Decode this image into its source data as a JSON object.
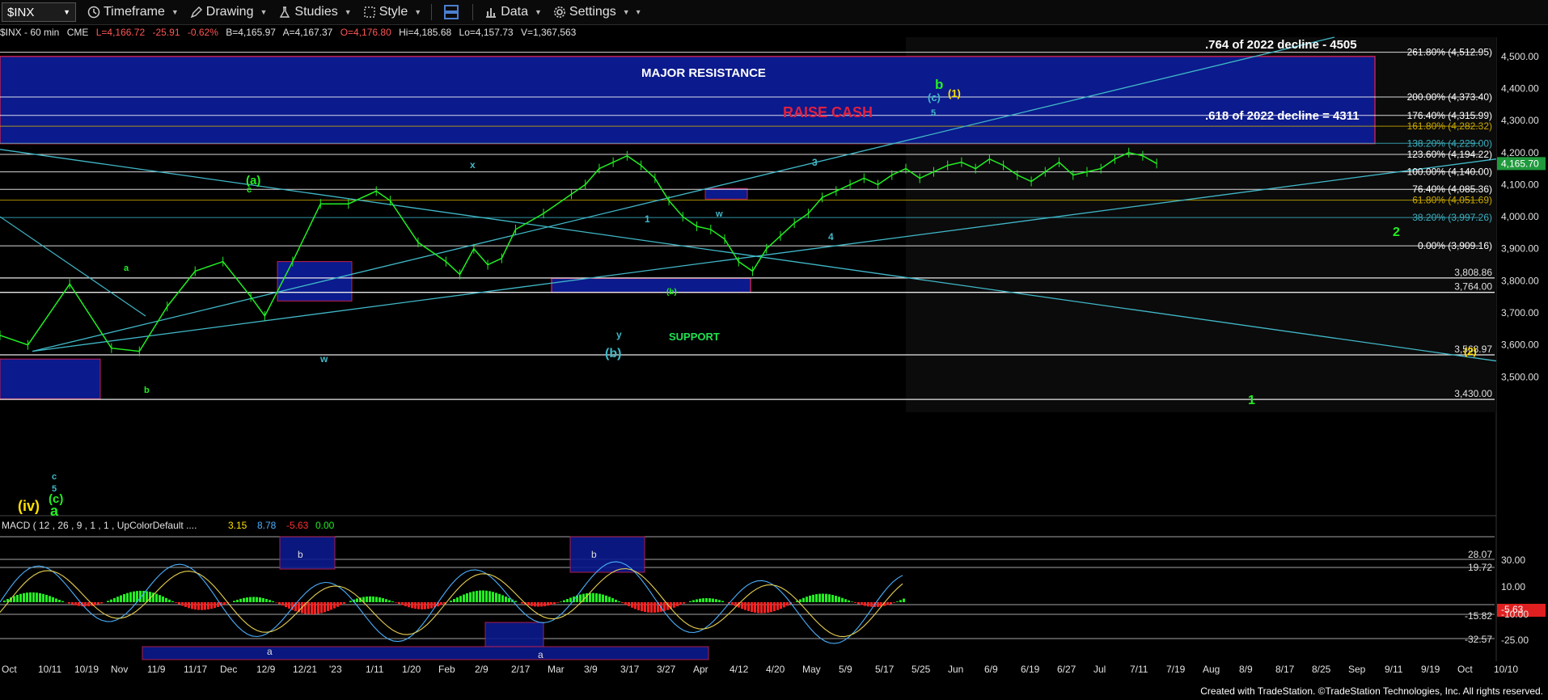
{
  "toolbar": {
    "symbol": "$INX",
    "timeframe": "Timeframe",
    "drawing": "Drawing",
    "studies": "Studies",
    "style": "Style",
    "data": "Data",
    "settings": "Settings"
  },
  "infobar": {
    "symbol": "$INX - 60 min",
    "exchange": "CME",
    "last": "L=4,166.72",
    "change": "-25.91",
    "change_pct": "-0.62%",
    "bid": "B=4,165.97",
    "ask": "A=4,167.37",
    "open": "O=4,176.80",
    "high": "Hi=4,185.68",
    "low": "Lo=4,157.73",
    "volume": "V=1,367,563"
  },
  "footer": "Created with TradeStation. ©TradeStation Technologies, Inc. All rights reserved.",
  "chart_data": {
    "type": "line",
    "title": "$INX - 60 min",
    "ylim": [
      3390,
      4560
    ],
    "y_ticks": [
      "4,500.00",
      "4,400.00",
      "4,300.00",
      "4,200.00",
      "4,100.00",
      "4,000.00",
      "3,900.00",
      "3,800.00",
      "3,700.00",
      "3,600.00",
      "3,500.00"
    ],
    "x_tick_labels": [
      "Oct",
      "10/11",
      "10/19",
      "Nov",
      "11/9",
      "11/17",
      "Dec",
      "12/9",
      "12/21",
      "'23",
      "1/11",
      "1/20",
      "Feb",
      "2/9",
      "2/17",
      "Mar",
      "3/9",
      "3/17",
      "3/27",
      "Apr",
      "4/12",
      "4/20",
      "May",
      "5/9",
      "5/17",
      "5/25",
      "Jun",
      "6/9",
      "6/19",
      "6/27",
      "Jul",
      "7/11",
      "7/19",
      "Aug",
      "8/9",
      "8/17",
      "8/25",
      "Sep",
      "9/11",
      "9/19",
      "Oct",
      "10/10"
    ],
    "last_price": "4,165.70",
    "price_series": [
      [
        0,
        3630
      ],
      [
        2,
        3600
      ],
      [
        5,
        3790
      ],
      [
        8,
        3590
      ],
      [
        10,
        3580
      ],
      [
        12,
        3720
      ],
      [
        14,
        3830
      ],
      [
        16,
        3860
      ],
      [
        18,
        3750
      ],
      [
        19,
        3690
      ],
      [
        21,
        3860
      ],
      [
        23,
        4040
      ],
      [
        25,
        4040
      ],
      [
        27,
        4080
      ],
      [
        28,
        4050
      ],
      [
        30,
        3920
      ],
      [
        32,
        3860
      ],
      [
        33,
        3820
      ],
      [
        34,
        3900
      ],
      [
        35,
        3850
      ],
      [
        36,
        3870
      ],
      [
        37,
        3960
      ],
      [
        39,
        4010
      ],
      [
        41,
        4070
      ],
      [
        42,
        4100
      ],
      [
        43,
        4150
      ],
      [
        44,
        4170
      ],
      [
        45,
        4190
      ],
      [
        46,
        4160
      ],
      [
        47,
        4120
      ],
      [
        48,
        4050
      ],
      [
        49,
        4000
      ],
      [
        50,
        3970
      ],
      [
        51,
        3960
      ],
      [
        52,
        3930
      ],
      [
        53,
        3860
      ],
      [
        54,
        3830
      ],
      [
        55,
        3900
      ],
      [
        56,
        3940
      ],
      [
        57,
        3980
      ],
      [
        58,
        4010
      ],
      [
        59,
        4060
      ],
      [
        60,
        4080
      ],
      [
        61,
        4100
      ],
      [
        62,
        4120
      ],
      [
        63,
        4100
      ],
      [
        64,
        4130
      ],
      [
        65,
        4150
      ],
      [
        66,
        4120
      ],
      [
        67,
        4140
      ],
      [
        68,
        4160
      ],
      [
        69,
        4170
      ],
      [
        70,
        4150
      ],
      [
        71,
        4180
      ],
      [
        72,
        4160
      ],
      [
        73,
        4130
      ],
      [
        74,
        4110
      ],
      [
        75,
        4140
      ],
      [
        76,
        4170
      ],
      [
        77,
        4130
      ],
      [
        78,
        4140
      ],
      [
        79,
        4150
      ],
      [
        80,
        4180
      ],
      [
        81,
        4200
      ],
      [
        82,
        4190
      ],
      [
        83,
        4166
      ]
    ],
    "fib_levels": [
      {
        "label": "261.80% (4,512.95)",
        "value": 4512.95,
        "color": "#ffffff"
      },
      {
        "label": "200.00% (4,373.40)",
        "value": 4373.4,
        "color": "#ffffff"
      },
      {
        "label": "176.40% (4,315.99)",
        "value": 4315.99,
        "color": "#ffffff"
      },
      {
        "label": "161.80% (4,282.32)",
        "value": 4282.32,
        "color": "#c8a800"
      },
      {
        "label": "138.20% (4,229.00)",
        "value": 4229.0,
        "color": "#3ab0c0"
      },
      {
        "label": "123.60% (4,194.22)",
        "value": 4194.22,
        "color": "#ffffff"
      },
      {
        "label": "100.00% (4,140.00)",
        "value": 4140.0,
        "color": "#ffffff"
      },
      {
        "label": "76.40% (4,085.36)",
        "value": 4085.36,
        "color": "#ffffff"
      },
      {
        "label": "61.80% (4,051.69)",
        "value": 4051.69,
        "color": "#c8a800"
      },
      {
        "label": "38.20% (3,997.26)",
        "value": 3997.26,
        "color": "#3ab0c0"
      },
      {
        "label": "0.00% (3,909.16)",
        "value": 3909.16,
        "color": "#ffffff"
      }
    ],
    "horizontal_levels": [
      "3,808.86",
      "3,764.00",
      "3,568.97",
      "3,430.00"
    ],
    "annotations": [
      ".764 of 2022 decline - 4505",
      ".618 of 2022 decline = 4311",
      "MAJOR RESISTANCE",
      "RAISE CASH",
      "SUPPORT"
    ],
    "wave_labels": [
      "(iv)",
      "(c)",
      "a",
      "b",
      "(c)",
      "(1)",
      "5",
      "(a)",
      "c",
      "a",
      "b",
      "x",
      "w",
      "y",
      "(b)",
      "1",
      "3",
      "4",
      "(b)",
      "2",
      "1",
      "(2)",
      "w",
      "c",
      "5"
    ],
    "macd": {
      "title": "MACD ( 12 , 26 , 9 , 1 , 1 , UpColorDefault ....",
      "values": [
        "3.15",
        "8.78",
        "-5.63",
        "0.00"
      ],
      "scale_labels": [
        "28.07",
        "19.72",
        "-15.82",
        "-32.57",
        "-5.63",
        "30.00",
        "10.00",
        "-10.00",
        "-25.00"
      ],
      "box_labels": [
        "b",
        "b",
        "a",
        "a"
      ]
    }
  }
}
